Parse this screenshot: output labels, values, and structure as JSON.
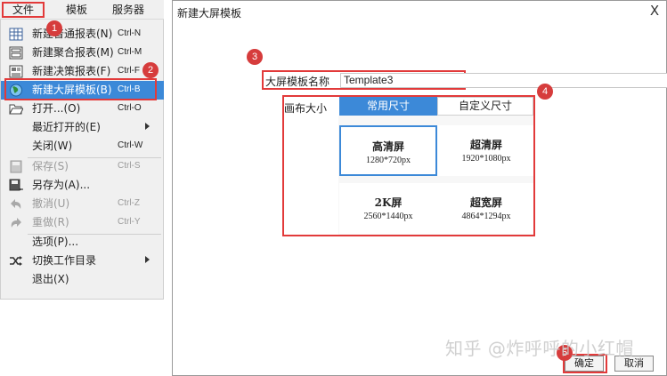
{
  "menubar": {
    "file": "文件",
    "template": "模板",
    "server": "服务器"
  },
  "file_menu": {
    "items": [
      {
        "label": "新建普通报表(N)",
        "shortcut": "Ctrl-N",
        "icon": "grid-report-icon"
      },
      {
        "label": "新建聚合报表(M)",
        "shortcut": "Ctrl-M",
        "icon": "aggregate-report-icon"
      },
      {
        "label": "新建决策报表(F)",
        "shortcut": "Ctrl-F",
        "icon": "decision-report-icon"
      },
      {
        "label": "新建大屏模板(B)",
        "shortcut": "Ctrl-B",
        "icon": "globe-icon"
      },
      {
        "label": "打开...(O)",
        "shortcut": "Ctrl-O",
        "icon": "folder-open-icon"
      },
      {
        "label": "最近打开的(E)",
        "shortcut": "",
        "icon": ""
      },
      {
        "label": "关闭(W)",
        "shortcut": "Ctrl-W",
        "icon": ""
      },
      {
        "label": "保存(S)",
        "shortcut": "Ctrl-S",
        "icon": "save-icon"
      },
      {
        "label": "另存为(A)...",
        "shortcut": "",
        "icon": "save-as-icon"
      },
      {
        "label": "撤消(U)",
        "shortcut": "Ctrl-Z",
        "icon": "undo-icon"
      },
      {
        "label": "重做(R)",
        "shortcut": "Ctrl-Y",
        "icon": "redo-icon"
      },
      {
        "label": "选项(P)...",
        "shortcut": "",
        "icon": ""
      },
      {
        "label": "切换工作目录",
        "shortcut": "",
        "icon": "switch-icon"
      },
      {
        "label": "退出(X)",
        "shortcut": "",
        "icon": ""
      }
    ]
  },
  "dialog": {
    "title": "新建大屏模板",
    "close_glyph": "X",
    "name_label": "大屏模板名称",
    "name_value": "Template3",
    "canvas_label": "画布大小",
    "tabs": [
      "常用尺寸",
      "自定义尺寸"
    ],
    "sizes": [
      {
        "name": "高清屏",
        "size": "1280*720px"
      },
      {
        "name": "超清屏",
        "size": "1920*1080px"
      },
      {
        "name": "2K屏",
        "size": "2560*1440px"
      },
      {
        "name": "超宽屏",
        "size": "4864*1294px"
      }
    ],
    "ok": "确定",
    "cancel": "取消"
  },
  "badges": [
    "1",
    "2",
    "3",
    "4",
    "5"
  ],
  "watermark": "知乎 @炸呼呼的小红帽",
  "colors": {
    "accent": "#3c89d8",
    "highlight_border": "#e23a3a",
    "badge": "#d63c3c"
  }
}
